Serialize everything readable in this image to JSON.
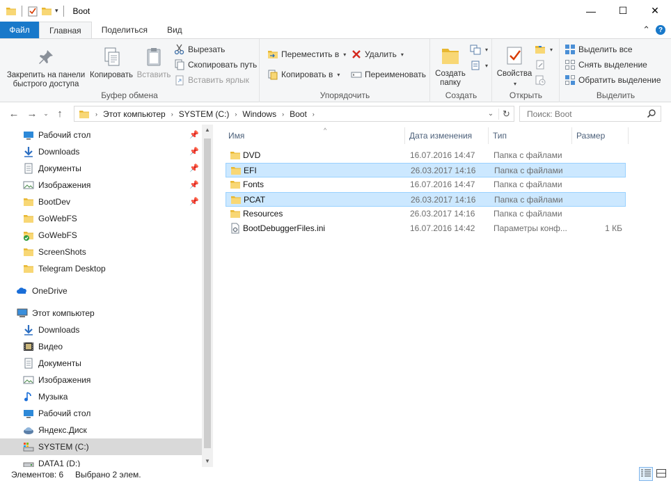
{
  "window": {
    "title": "Boot",
    "minimize": "—",
    "maximize": "☐",
    "close": "✕"
  },
  "tabs": {
    "file": "Файл",
    "home": "Главная",
    "share": "Поделиться",
    "view": "Вид",
    "collapse": "⌃",
    "help": "?"
  },
  "ribbon": {
    "clipboard": {
      "label": "Буфер обмена",
      "pin_line1": "Закрепить на панели",
      "pin_line2": "быстрого доступа",
      "copy": "Копировать",
      "paste": "Вставить",
      "cut": "Вырезать",
      "copy_path": "Скопировать путь",
      "paste_shortcut": "Вставить ярлык"
    },
    "organize": {
      "label": "Упорядочить",
      "move_to": "Переместить в",
      "copy_to": "Копировать в",
      "delete": "Удалить",
      "rename": "Переименовать"
    },
    "new": {
      "label": "Создать",
      "new_folder_line1": "Создать",
      "new_folder_line2": "папку"
    },
    "open": {
      "label": "Открыть",
      "properties": "Свойства"
    },
    "select": {
      "label": "Выделить",
      "select_all": "Выделить все",
      "select_none": "Снять выделение",
      "invert": "Обратить выделение"
    }
  },
  "address": {
    "crumbs": [
      "Этот компьютер",
      "SYSTEM (C:)",
      "Windows",
      "Boot"
    ],
    "search_placeholder": "Поиск: Boot"
  },
  "nav": {
    "quick_access": [
      {
        "label": "Рабочий стол",
        "icon": "desktop-icon",
        "pinned": true
      },
      {
        "label": "Downloads",
        "icon": "download-icon",
        "pinned": true
      },
      {
        "label": "Документы",
        "icon": "documents-icon",
        "pinned": true
      },
      {
        "label": "Изображения",
        "icon": "pictures-icon",
        "pinned": true
      },
      {
        "label": "BootDev",
        "icon": "folder-icon",
        "pinned": true
      },
      {
        "label": "GoWebFS",
        "icon": "folder-icon",
        "pinned": false
      },
      {
        "label": "GoWebFS",
        "icon": "folder-sync-icon",
        "pinned": false
      },
      {
        "label": "ScreenShots",
        "icon": "folder-icon",
        "pinned": false
      },
      {
        "label": "Telegram Desktop",
        "icon": "folder-icon",
        "pinned": false
      }
    ],
    "onedrive": "OneDrive",
    "this_pc": "Этот компьютер",
    "pc_items": [
      {
        "label": "Downloads",
        "icon": "download-icon"
      },
      {
        "label": "Видео",
        "icon": "video-icon"
      },
      {
        "label": "Документы",
        "icon": "documents-icon"
      },
      {
        "label": "Изображения",
        "icon": "pictures-icon"
      },
      {
        "label": "Музыка",
        "icon": "music-icon"
      },
      {
        "label": "Рабочий стол",
        "icon": "desktop-icon"
      },
      {
        "label": "Яндекс.Диск",
        "icon": "yandex-disk-icon"
      },
      {
        "label": "SYSTEM (C:)",
        "icon": "system-drive-icon"
      },
      {
        "label": "DATA1 (D:)",
        "icon": "drive-icon"
      }
    ]
  },
  "columns": {
    "name": "Имя",
    "date": "Дата изменения",
    "type": "Тип",
    "size": "Размер"
  },
  "files": [
    {
      "name": "DVD",
      "date": "16.07.2016 14:47",
      "type": "Папка с файлами",
      "size": "",
      "kind": "folder",
      "selected": false
    },
    {
      "name": "EFI",
      "date": "26.03.2017 14:16",
      "type": "Папка с файлами",
      "size": "",
      "kind": "folder",
      "selected": true
    },
    {
      "name": "Fonts",
      "date": "16.07.2016 14:47",
      "type": "Папка с файлами",
      "size": "",
      "kind": "folder",
      "selected": false
    },
    {
      "name": "PCAT",
      "date": "26.03.2017 14:16",
      "type": "Папка с файлами",
      "size": "",
      "kind": "folder",
      "selected": true
    },
    {
      "name": "Resources",
      "date": "26.03.2017 14:16",
      "type": "Папка с файлами",
      "size": "",
      "kind": "folder",
      "selected": false
    },
    {
      "name": "BootDebuggerFiles.ini",
      "date": "16.07.2016 14:42",
      "type": "Параметры конф...",
      "size": "1 КБ",
      "kind": "ini",
      "selected": false
    }
  ],
  "status": {
    "count": "Элементов: 6",
    "selected": "Выбрано 2 элем."
  },
  "colors": {
    "accent": "#1979ca",
    "selection": "#cce8ff",
    "folder": "#f8d775"
  }
}
